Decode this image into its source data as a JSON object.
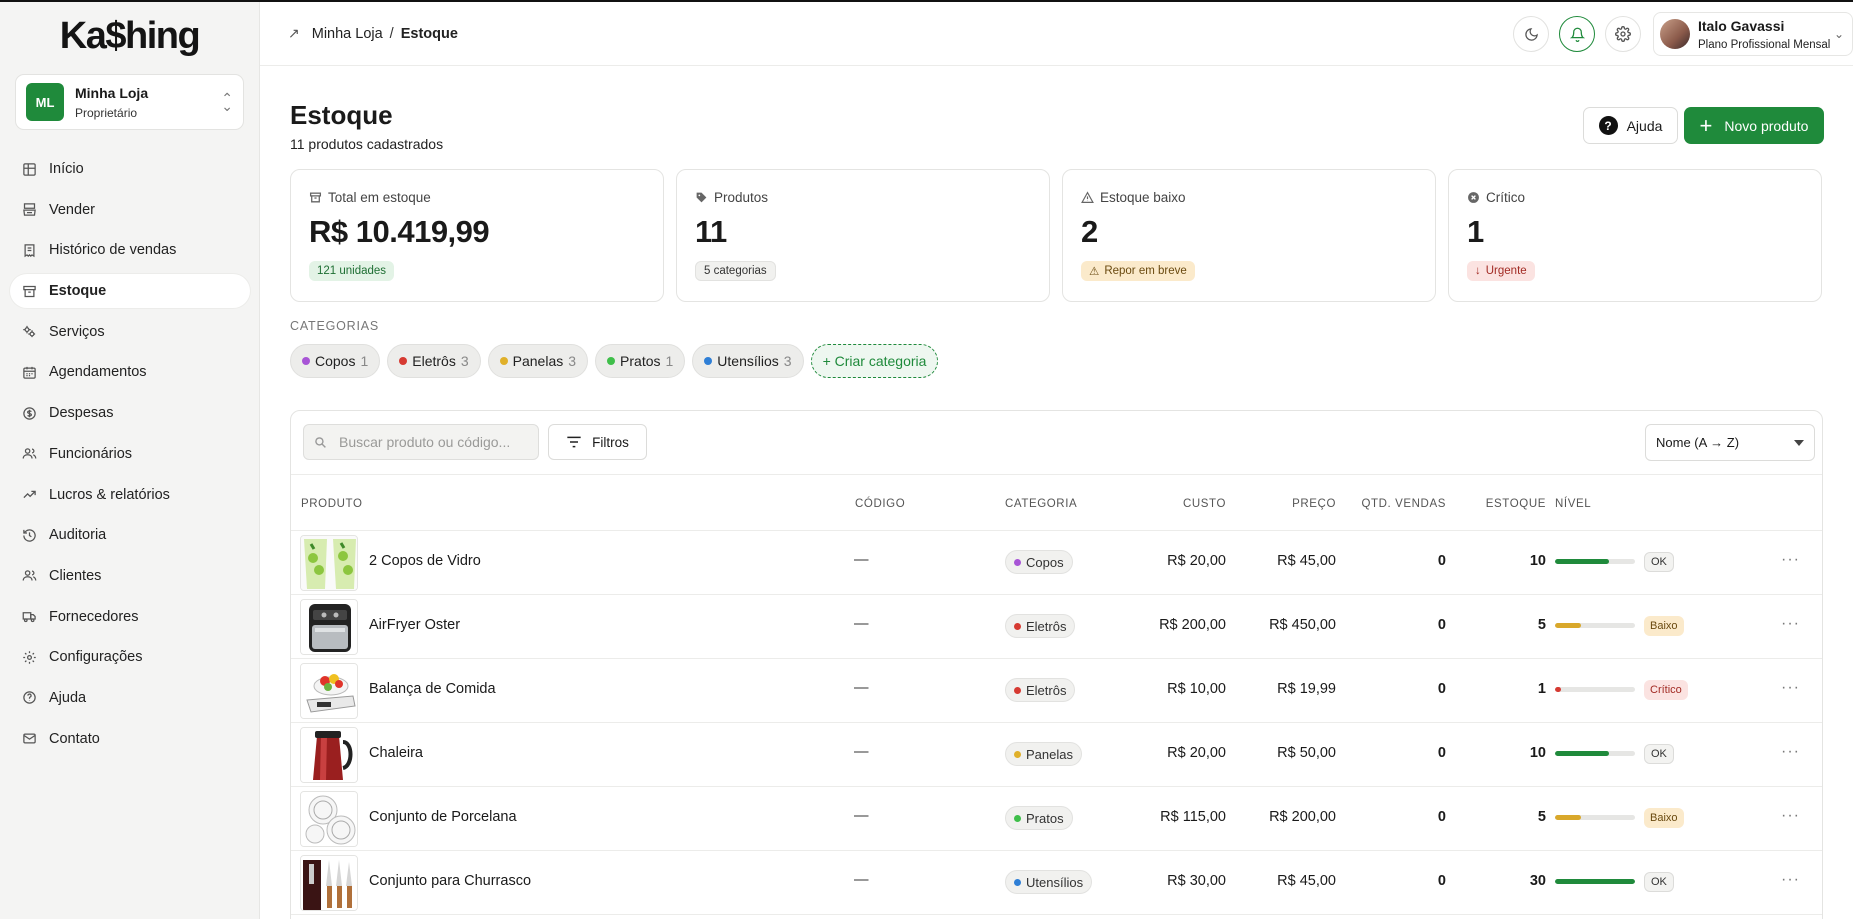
{
  "brand": {
    "logo": "Ka$hing"
  },
  "store": {
    "initials": "ML",
    "name": "Minha Loja",
    "role": "Proprietário"
  },
  "sidebar": {
    "items": [
      {
        "label": "Início",
        "icon": "grid-icon"
      },
      {
        "label": "Vender",
        "icon": "register-icon"
      },
      {
        "label": "Histórico de vendas",
        "icon": "receipt-icon"
      },
      {
        "label": "Estoque",
        "icon": "box-icon",
        "active": true
      },
      {
        "label": "Serviços",
        "icon": "gears-icon"
      },
      {
        "label": "Agendamentos",
        "icon": "calendar-icon"
      },
      {
        "label": "Despesas",
        "icon": "dollar-circle-icon"
      },
      {
        "label": "Funcionários",
        "icon": "users-icon"
      },
      {
        "label": "Lucros & relatórios",
        "icon": "trend-icon"
      },
      {
        "label": "Auditoria",
        "icon": "history-icon"
      },
      {
        "label": "Clientes",
        "icon": "clients-icon"
      },
      {
        "label": "Fornecedores",
        "icon": "truck-icon"
      },
      {
        "label": "Configurações",
        "icon": "gear-icon"
      },
      {
        "label": "Ajuda",
        "icon": "help-circle-icon"
      },
      {
        "label": "Contato",
        "icon": "mail-icon"
      }
    ]
  },
  "topbar": {
    "crumb_parent": "Minha Loja",
    "crumb_sep": "/",
    "crumb_current": "Estoque"
  },
  "user": {
    "name": "Italo Gavassi",
    "plan": "Plano Profissional Mensal"
  },
  "header": {
    "title": "Estoque",
    "subtitle": "11 produtos cadastrados",
    "help_label": "Ajuda",
    "new_label": "Novo produto"
  },
  "cards": [
    {
      "label": "Total em estoque",
      "value": "R$ 10.419,99",
      "badge": "121 unidades"
    },
    {
      "label": "Produtos",
      "value": "11",
      "badge": "5 categorias"
    },
    {
      "label": "Estoque baixo",
      "value": "2",
      "badge": "Repor em breve"
    },
    {
      "label": "Crítico",
      "value": "1",
      "badge": "Urgente"
    }
  ],
  "categories": {
    "heading": "CATEGORIAS",
    "items": [
      {
        "name": "Copos",
        "count": "1",
        "color": "#a855d6"
      },
      {
        "name": "Eletrôs",
        "count": "3",
        "color": "#d63a32"
      },
      {
        "name": "Panelas",
        "count": "3",
        "color": "#e0b02a"
      },
      {
        "name": "Pratos",
        "count": "1",
        "color": "#3fbf4a"
      },
      {
        "name": "Utensílios",
        "count": "3",
        "color": "#2f7fd6"
      }
    ],
    "create_label": "+ Criar categoria"
  },
  "toolbar": {
    "search_placeholder": "Buscar produto ou código...",
    "filter_label": "Filtros",
    "sort_value": "Nome (A → Z)"
  },
  "table": {
    "columns": [
      "PRODUTO",
      "CÓDIGO",
      "CATEGORIA",
      "CUSTO",
      "PREÇO",
      "QTD. VENDAS",
      "ESTOQUE",
      "NÍVEL"
    ],
    "rows": [
      {
        "name": "2 Copos de Vidro",
        "code": "—",
        "category": "Copos",
        "cat_color": "#a855d6",
        "cost": "R$ 20,00",
        "price": "R$ 45,00",
        "sales": "0",
        "stock": "10",
        "level": 0.67,
        "level_color": "#1f8a3b",
        "status": "OK",
        "status_kind": "ok",
        "thumb": "glasses"
      },
      {
        "name": "AirFryer Oster",
        "code": "—",
        "category": "Eletrôs",
        "cat_color": "#d63a32",
        "cost": "R$ 200,00",
        "price": "R$ 450,00",
        "sales": "0",
        "stock": "5",
        "level": 0.33,
        "level_color": "#d9a82b",
        "status": "Baixo",
        "status_kind": "low",
        "thumb": "airfryer"
      },
      {
        "name": "Balança de Comida",
        "code": "—",
        "category": "Eletrôs",
        "cat_color": "#d63a32",
        "cost": "R$ 10,00",
        "price": "R$ 19,99",
        "sales": "0",
        "stock": "1",
        "level": 0.07,
        "level_color": "#d63a32",
        "status": "Crítico",
        "status_kind": "crit",
        "thumb": "scale"
      },
      {
        "name": "Chaleira",
        "code": "—",
        "category": "Panelas",
        "cat_color": "#e0b02a",
        "cost": "R$ 20,00",
        "price": "R$ 50,00",
        "sales": "0",
        "stock": "10",
        "level": 0.67,
        "level_color": "#1f8a3b",
        "status": "OK",
        "status_kind": "ok",
        "thumb": "kettle"
      },
      {
        "name": "Conjunto de Porcelana",
        "code": "—",
        "category": "Pratos",
        "cat_color": "#3fbf4a",
        "cost": "R$ 115,00",
        "price": "R$ 200,00",
        "sales": "0",
        "stock": "5",
        "level": 0.33,
        "level_color": "#d9a82b",
        "status": "Baixo",
        "status_kind": "low",
        "thumb": "plates"
      },
      {
        "name": "Conjunto para Churrasco",
        "code": "—",
        "category": "Utensílios",
        "cat_color": "#2f7fd6",
        "cost": "R$ 30,00",
        "price": "R$ 45,00",
        "sales": "0",
        "stock": "30",
        "level": 1.0,
        "level_color": "#1f8a3b",
        "status": "OK",
        "status_kind": "ok",
        "thumb": "knives"
      }
    ]
  }
}
